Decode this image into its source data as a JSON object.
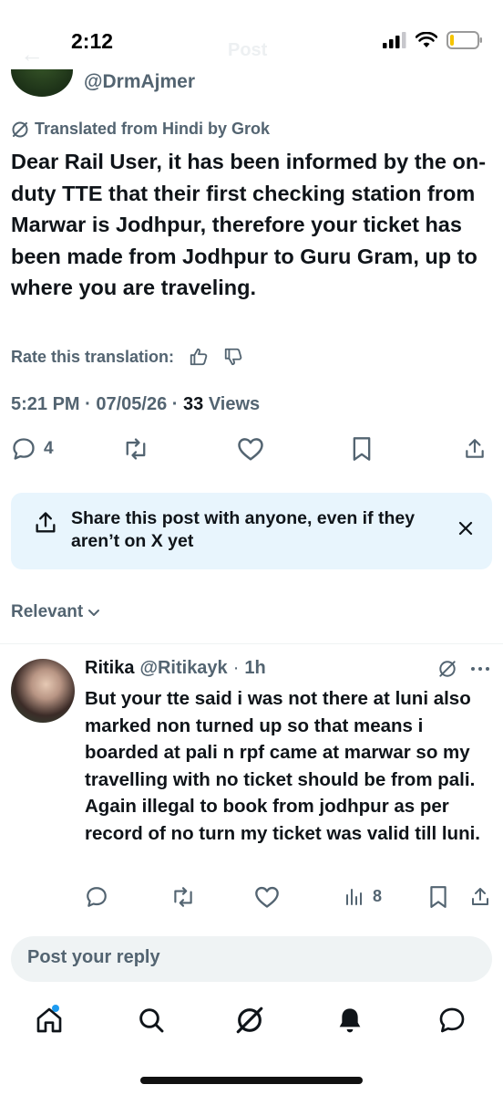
{
  "status_bar": {
    "time": "2:12",
    "ghost_header_title": "Post"
  },
  "author": {
    "handle": "@DrmAjmer"
  },
  "translation": {
    "label": "Translated from Hindi by Grok",
    "rate_label": "Rate this translation:"
  },
  "post": {
    "text": "Dear Rail User, it has been informed by the on-duty TTE that their first checking station from Marwar is Jodhpur, therefore your ticket has been made from Jodhpur to Guru Gram, up to where you are traveling.",
    "time": "5:21 PM",
    "date": "07/05/26",
    "views_count": "33",
    "views_label": "Views",
    "reply_count": "4"
  },
  "share_banner": {
    "text": "Share this post with anyone, even if they aren’t on X yet"
  },
  "filter": {
    "label": "Relevant"
  },
  "reply": {
    "name": "Ritika",
    "handle": "@Ritikayk",
    "time": "1h",
    "text": "But your tte said i was not there at luni also marked non turned up so that means i boarded at pali n rpf came at marwar so my travelling with no ticket should be from pali. Again illegal to book from jodhpur as per record of no turn my ticket was valid till luni.",
    "views_count": "8"
  },
  "composer": {
    "placeholder": "Post your reply"
  },
  "colors": {
    "text_primary": "#0f1419",
    "text_secondary": "#536471",
    "accent": "#1d9bf0",
    "banner_bg": "#e8f5fd",
    "composer_bg": "#eff3f4"
  },
  "icons": [
    "signal-icon",
    "wifi-icon",
    "battery-icon",
    "grok-icon",
    "thumbs-up-icon",
    "thumbs-down-icon",
    "reply-icon",
    "repost-icon",
    "like-icon",
    "bookmark-icon",
    "share-icon",
    "close-icon",
    "chevron-down-icon",
    "more-icon",
    "views-icon",
    "home-icon",
    "search-icon",
    "grok-nav-icon",
    "notifications-icon",
    "messages-icon"
  ]
}
